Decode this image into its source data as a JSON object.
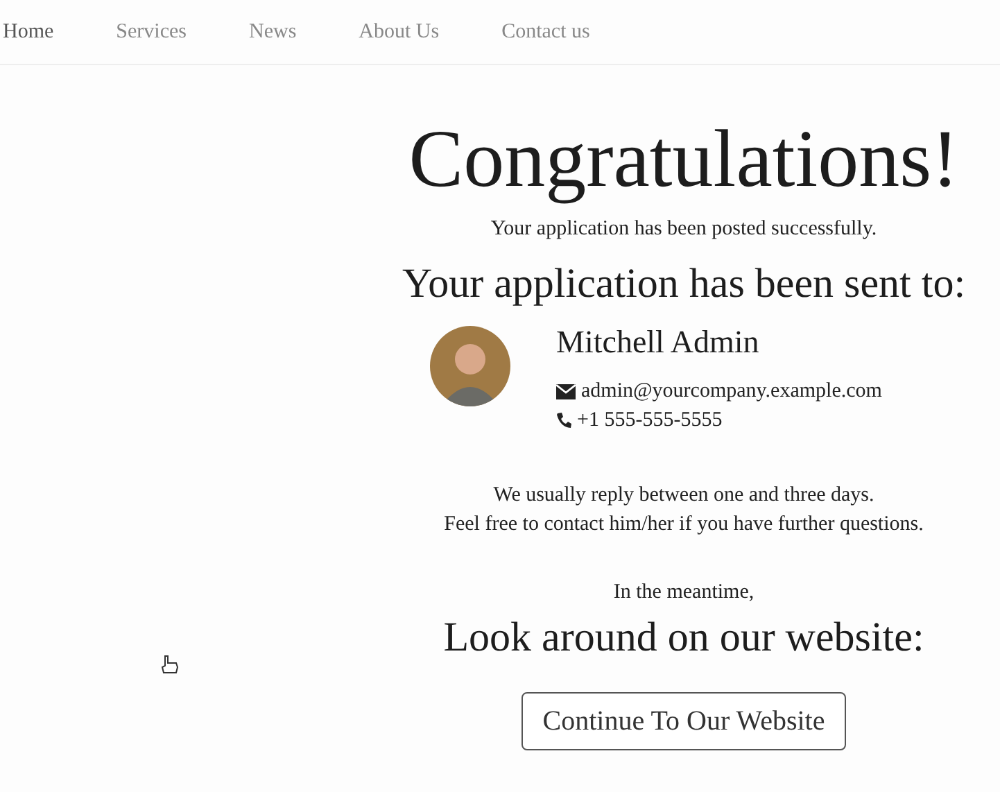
{
  "nav": [
    {
      "label": "Home",
      "selected": true
    },
    {
      "label": "Services",
      "selected": false
    },
    {
      "label": "News",
      "selected": false
    },
    {
      "label": "About Us",
      "selected": false
    },
    {
      "label": "Contact us",
      "selected": false
    }
  ],
  "title": "Congratulations!",
  "subtitle": "Your application has been posted successfully.",
  "sent_heading": "Your application has been sent to:",
  "contact": {
    "name": "Mitchell Admin",
    "email": "admin@yourcompany.example.com",
    "phone": "+1 555-555-5555"
  },
  "reply_lines": [
    "We usually reply between one and three days.",
    "Feel free to contact him/her if you have further questions."
  ],
  "meantime": "In the meantime,",
  "look_heading": "Look around on our website:",
  "button": "Continue To Our Website"
}
